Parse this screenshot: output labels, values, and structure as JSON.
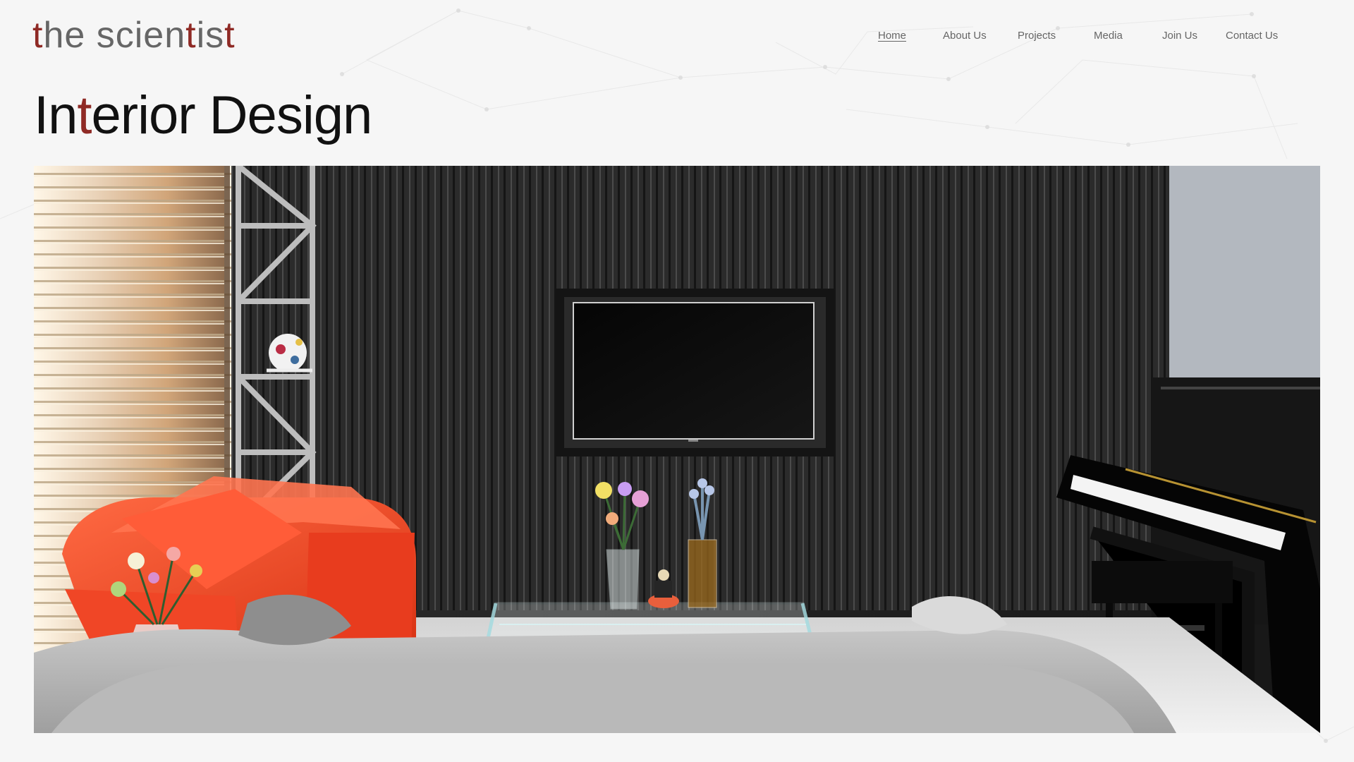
{
  "site": {
    "logo": {
      "prefix": "",
      "first_t": "t",
      "middle": "he scien",
      "second_t": "t",
      "middle2": "is",
      "third_t": "t"
    },
    "nav": {
      "home": "Home",
      "about": "About Us",
      "projects": "Projects",
      "media": "Media",
      "join": "Join Us",
      "contact": "Contact Us"
    }
  },
  "page": {
    "title_part1": "In",
    "title_accent": "t",
    "title_part2": "erior Design"
  },
  "theme": {
    "background": "#f6f6f6",
    "text": "#111111",
    "muted_text": "#666666",
    "accent": "#8f2a25",
    "sofa": "#ff5a32",
    "wall": "#303030",
    "floor": "#e8e8e8"
  },
  "hero": {
    "image_label": ""
  }
}
